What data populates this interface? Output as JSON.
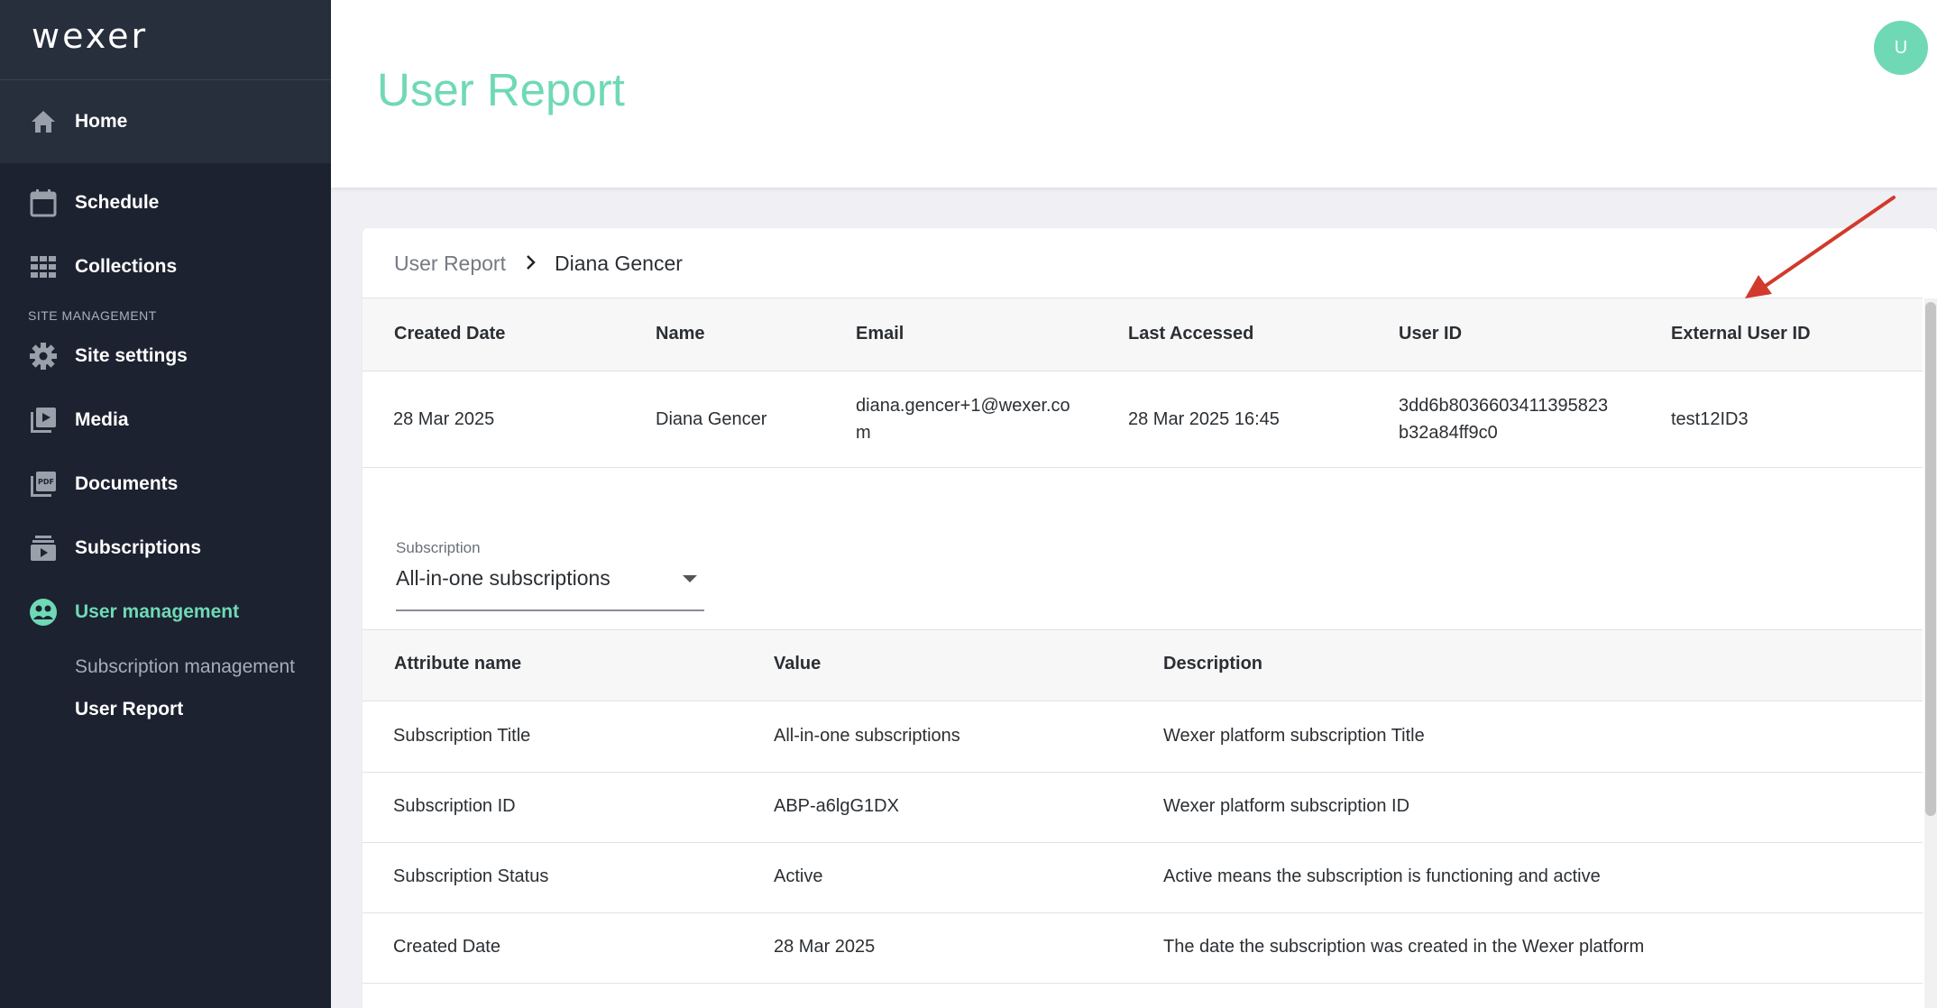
{
  "app": {
    "logo": "wexer"
  },
  "sidebar": {
    "home": "Home",
    "items": [
      {
        "label": "Schedule",
        "icon": "calendar-icon"
      },
      {
        "label": "Collections",
        "icon": "grid-icon"
      }
    ],
    "section_label": "SITE MANAGEMENT",
    "manage_items": [
      {
        "label": "Site settings",
        "icon": "gear-icon"
      },
      {
        "label": "Media",
        "icon": "video-library-icon"
      },
      {
        "label": "Documents",
        "icon": "pdf-icon"
      },
      {
        "label": "Subscriptions",
        "icon": "subscriptions-icon"
      },
      {
        "label": "User management",
        "icon": "users-icon"
      }
    ],
    "sub_items": [
      "Subscription management",
      "User Report"
    ],
    "accent": "#6fd9b6",
    "bg": "#1c2230"
  },
  "header": {
    "title": "User Report",
    "avatar_initial": "U"
  },
  "breadcrumb": {
    "parent": "User Report",
    "current": "Diana Gencer"
  },
  "user_table": {
    "headers": [
      "Created Date",
      "Name",
      "Email",
      "Last Accessed",
      "User ID",
      "External User ID"
    ],
    "row": {
      "created": "28 Mar 2025",
      "name": "Diana Gencer",
      "email_line1": "diana.gencer+1@wexer.co",
      "email_line2": "m",
      "last_accessed": "28 Mar 2025 16:45",
      "user_id_line1": "3dd6b8036603411395823",
      "user_id_line2": "b32a84ff9c0",
      "external_id": "test12ID3"
    }
  },
  "subscription_select": {
    "label": "Subscription",
    "value": "All-in-one subscriptions"
  },
  "attr_table": {
    "headers": [
      "Attribute name",
      "Value",
      "Description"
    ],
    "rows": [
      [
        "Subscription Title",
        "All-in-one subscriptions",
        "Wexer platform subscription Title"
      ],
      [
        "Subscription ID",
        "ABP-a6lgG1DX",
        "Wexer platform subscription ID"
      ],
      [
        "Subscription Status",
        "Active",
        "Active means the subscription is functioning and active"
      ],
      [
        "Created Date",
        "28 Mar 2025",
        "The date the subscription was created in the Wexer platform"
      ]
    ]
  },
  "annotation_color": "#d13a2c"
}
